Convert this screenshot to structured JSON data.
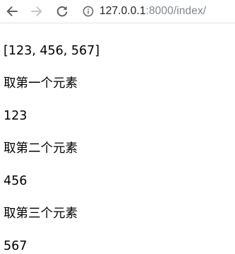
{
  "browser": {
    "url_host": "127.0.0.1",
    "url_rest": ":8000/index/",
    "icons": {
      "back": "arrow-left-icon",
      "forward": "arrow-right-icon",
      "reload": "reload-icon",
      "info": "info-icon"
    }
  },
  "page": {
    "lines": [
      "[123, 456, 567]",
      "取第一个元素",
      "123",
      "取第二个元素",
      "456",
      "取第三个元素",
      "567"
    ]
  }
}
